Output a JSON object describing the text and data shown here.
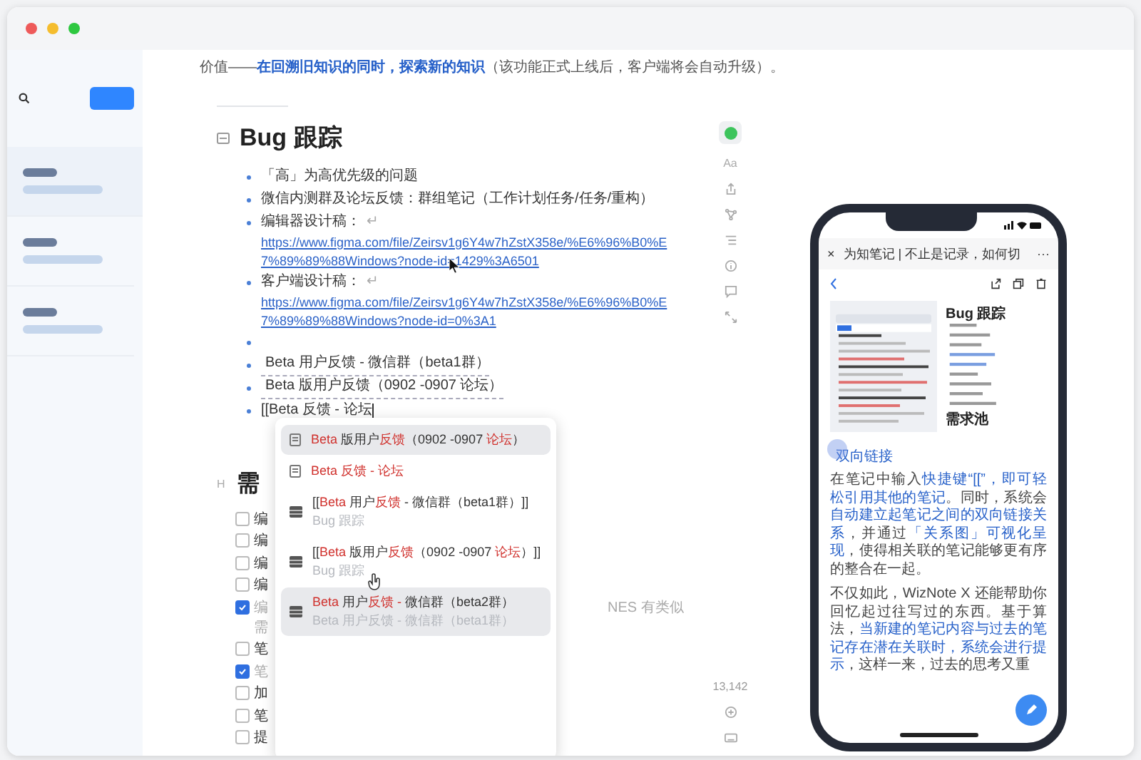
{
  "sidebar": {
    "notes": [
      {
        "selected": true
      },
      {
        "selected": false
      },
      {
        "selected": false
      }
    ]
  },
  "editor": {
    "intro": "价值——**在回溯旧知识的同时，探索新的知识**（该功能正式上线后，客户端将会自动升级）。",
    "heading": "Bug 跟踪",
    "bullets": [
      {
        "kind": "text",
        "text": "「高」为高优先级的问题"
      },
      {
        "kind": "text",
        "text": "微信内测群及论坛反馈：群组笔记（工作计划任务/任务/重构）"
      },
      {
        "kind": "design",
        "text": "编辑器设计稿：",
        "mark": "↵",
        "link": "https://www.figma.com/file/Zeirsv1g6Y4w7hZstX358e/%E6%96%B0%E7%89%89%88Windows?node-id=1429%3A6501"
      },
      {
        "kind": "design",
        "text": "客户端设计稿：",
        "mark": "↵",
        "link": "https://www.figma.com/file/Zeirsv1g6Y4w7hZstX358e/%E6%96%B0%E7%89%89%88Windows?node-id=0%3A1"
      },
      {
        "kind": "empty"
      },
      {
        "kind": "link",
        "text": "Beta 用户反馈 - 微信群（beta1群）"
      },
      {
        "kind": "link",
        "text": "Beta 版用户反馈（0902 -0907 论坛）"
      },
      {
        "kind": "typing",
        "text": "[[Beta 反馈 - 论坛"
      }
    ],
    "section_icon": "H",
    "section_heading": "需",
    "checklist": [
      {
        "checked": false,
        "text": "编"
      },
      {
        "checked": false,
        "text": "编"
      },
      {
        "checked": false,
        "text": "编"
      },
      {
        "checked": false,
        "text": "编"
      },
      {
        "checked": true,
        "text": "编",
        "tail": "NES 有类似",
        "more": "需"
      },
      {
        "checked": false,
        "text": "笔"
      },
      {
        "checked": true,
        "text": "笔"
      },
      {
        "checked": false,
        "text": "加"
      },
      {
        "checked": false,
        "text": "笔"
      },
      {
        "checked": false,
        "text": "提"
      }
    ],
    "suggestions": [
      {
        "kind": "note",
        "selected": true,
        "title": "**Beta** 版用户**反馈**（0902 -0907 **论坛**）"
      },
      {
        "kind": "note",
        "selected": false,
        "title": "**Beta 反馈 - 论坛**"
      },
      {
        "kind": "block",
        "selected": false,
        "title": "[[**Beta** 用户**反馈** - 微信群（beta1群）]]",
        "subtitle": "Bug 跟踪"
      },
      {
        "kind": "block",
        "selected": false,
        "title": "[[**Beta** 版用户**反馈**（0902 -0907 **论坛**）]]",
        "subtitle": "Bug 跟踪"
      },
      {
        "kind": "block",
        "selected": true,
        "title": "**Beta** 用户**反馈 -** 微信群（beta2群）",
        "subtitle": "Beta 用户反馈 - 微信群（beta1群）"
      }
    ]
  },
  "toolbar": {
    "font_button": "Aa",
    "word_count": "13,142"
  },
  "phone": {
    "close": "×",
    "title": "为知笔记 | 不止是记录，如何切",
    "more": "···",
    "mini_heading": "Bug 跟踪",
    "mini_section": "需求池",
    "article_heading": "双向链接",
    "paragraphs": [
      "在笔记中输入**快捷键“[[”，即可轻松引用其他的笔记**。同时，系统会**自动建立起笔记之间的双向链接关系**，并通过**「关系图」可视化呈现**，使得相关联的笔记能够更有序的整合在一起。",
      "不仅如此，WizNote X 还能帮助你回忆起过往写过的东西。基于算法，**当新建的笔记内容与过去的笔记存在潜在关联时，系统会进行提示**，这样一来，过去的思考又重"
    ]
  }
}
